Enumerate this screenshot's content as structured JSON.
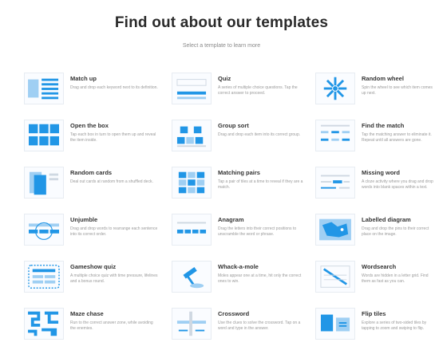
{
  "header": {
    "title": "Find out about our templates",
    "subtitle": "Select a template to learn more"
  },
  "accent_color": "#2196e6",
  "templates": [
    {
      "name": "Match up",
      "icon": "match-up-icon",
      "desc": "Drag and drop each keyword next to its definition."
    },
    {
      "name": "Quiz",
      "icon": "quiz-icon",
      "desc": "A series of multiple choice questions. Tap the correct answer to proceed."
    },
    {
      "name": "Random wheel",
      "icon": "random-wheel-icon",
      "desc": "Spin the wheel to see which item comes up next."
    },
    {
      "name": "Open the box",
      "icon": "open-the-box-icon",
      "desc": "Tap each box in turn to open them up and reveal the item inside."
    },
    {
      "name": "Group sort",
      "icon": "group-sort-icon",
      "desc": "Drag and drop each item into its correct group."
    },
    {
      "name": "Find the match",
      "icon": "find-the-match-icon",
      "desc": "Tap the matching answer to eliminate it. Repeat until all answers are gone."
    },
    {
      "name": "Random cards",
      "icon": "random-cards-icon",
      "desc": "Deal out cards at random from a shuffled deck."
    },
    {
      "name": "Matching pairs",
      "icon": "matching-pairs-icon",
      "desc": "Tap a pair of tiles at a time to reveal if they are a match."
    },
    {
      "name": "Missing word",
      "icon": "missing-word-icon",
      "desc": "A cloze activity where you drag and drop words into blank spaces within a text."
    },
    {
      "name": "Unjumble",
      "icon": "unjumble-icon",
      "desc": "Drag and drop words to rearrange each sentence into its correct order."
    },
    {
      "name": "Anagram",
      "icon": "anagram-icon",
      "desc": "Drag the letters into their correct positions to unscramble the word or phrase."
    },
    {
      "name": "Labelled diagram",
      "icon": "labelled-diagram-icon",
      "desc": "Drag and drop the pins to their correct place on the image."
    },
    {
      "name": "Gameshow quiz",
      "icon": "gameshow-quiz-icon",
      "desc": "A multiple choice quiz with time pressure, lifelines and a bonus round."
    },
    {
      "name": "Whack-a-mole",
      "icon": "whack-a-mole-icon",
      "desc": "Moles appear one at a time, hit only the correct ones to win."
    },
    {
      "name": "Wordsearch",
      "icon": "wordsearch-icon",
      "desc": "Words are hidden in a letter grid. Find them as fast as you can."
    },
    {
      "name": "Maze chase",
      "icon": "maze-chase-icon",
      "desc": "Run to the correct answer zone, while avoiding the enemies."
    },
    {
      "name": "Crossword",
      "icon": "crossword-icon",
      "desc": "Use the clues to solve the crossword. Tap on a word and type in the answer."
    },
    {
      "name": "Flip tiles",
      "icon": "flip-tiles-icon",
      "desc": "Explore a series of two-sided tiles by tapping to zoom and swiping to flip."
    }
  ]
}
